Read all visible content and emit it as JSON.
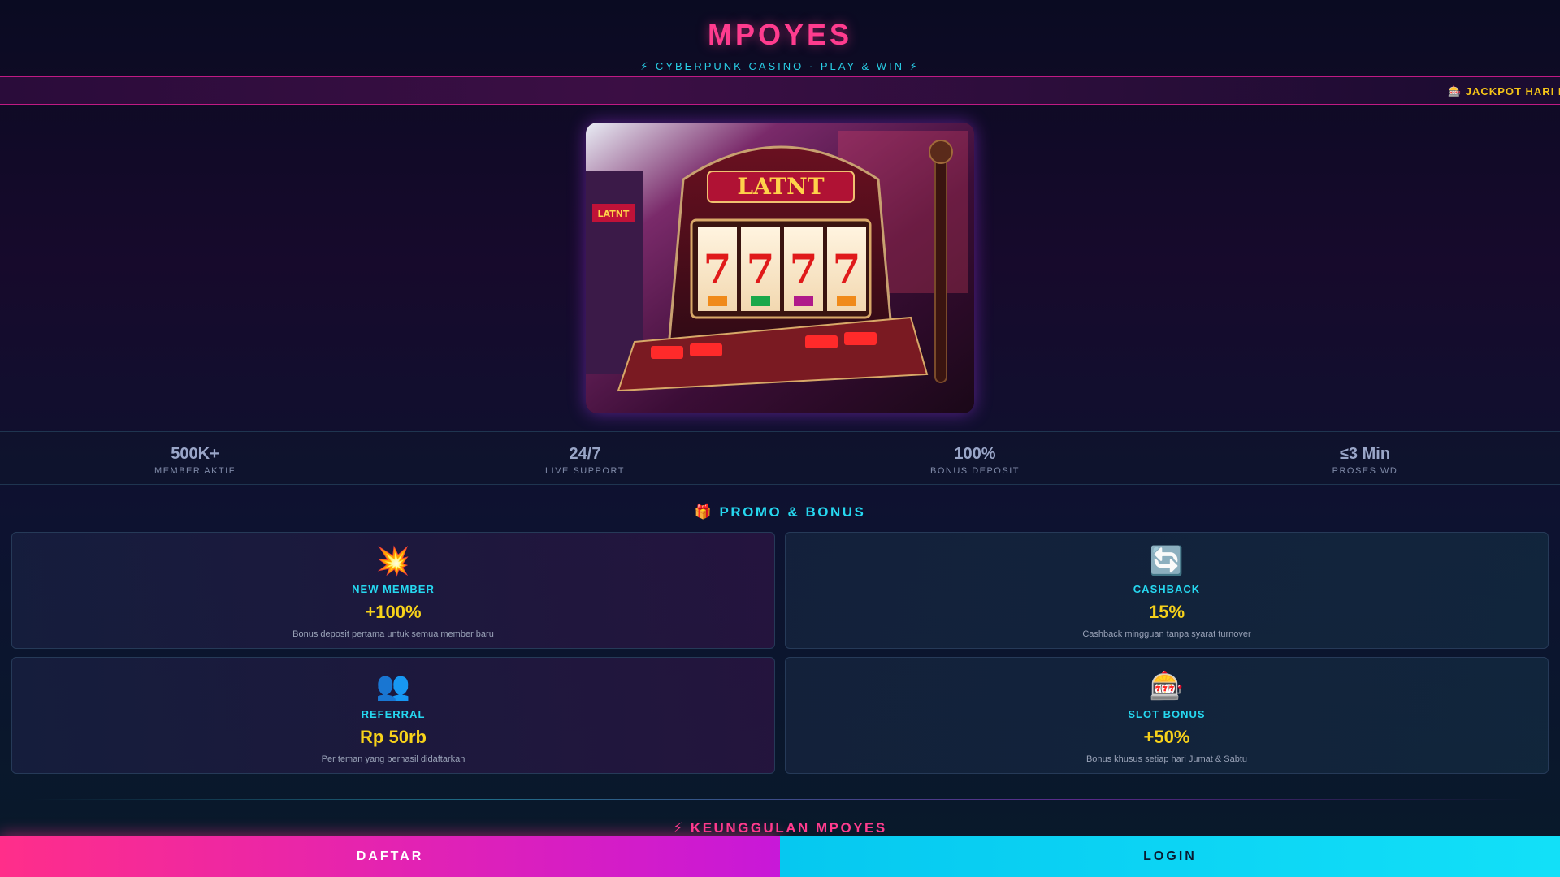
{
  "header": {
    "brand": "MPOYES",
    "tagline": "⚡ CYBERPUNK CASINO · PLAY & WIN ⚡"
  },
  "ticker": {
    "text": "🎰 JACKPOT HARI IN"
  },
  "hero": {
    "machine_label": "LATNT",
    "side_label": "LATNT",
    "reels": [
      "7",
      "7",
      "7",
      "7"
    ]
  },
  "stats": [
    {
      "value": "500K+",
      "label": "MEMBER AKTIF"
    },
    {
      "value": "24/7",
      "label": "LIVE SUPPORT"
    },
    {
      "value": "100%",
      "label": "BONUS DEPOSIT"
    },
    {
      "value": "≤3 Min",
      "label": "PROSES WD"
    }
  ],
  "promo": {
    "title": "🎁 PROMO & BONUS",
    "cards": [
      {
        "icon": "💥",
        "icon_name": "explosion-icon",
        "name": "NEW MEMBER",
        "value": "+100%",
        "desc": "Bonus deposit pertama untuk semua member baru"
      },
      {
        "icon": "🔄",
        "icon_name": "refresh-icon",
        "name": "CASHBACK",
        "value": "15%",
        "desc": "Cashback mingguan tanpa syarat turnover"
      },
      {
        "icon": "👥",
        "icon_name": "people-icon",
        "name": "REFERRAL",
        "value": "Rp 50rb",
        "desc": "Per teman yang berhasil didaftarkan"
      },
      {
        "icon": "🎰",
        "icon_name": "slot-machine-icon",
        "name": "SLOT BONUS",
        "value": "+50%",
        "desc": "Bonus khusus setiap hari Jumat & Sabtu"
      }
    ]
  },
  "advantages": {
    "title": "⚡ KEUNGGULAN MPOYES"
  },
  "actions": {
    "daftar": "DAFTAR",
    "login": "LOGIN"
  },
  "colors": {
    "accent_pink": "#ff3c8e",
    "accent_cyan": "#26d8f0",
    "value_yellow": "#f7d21a"
  }
}
